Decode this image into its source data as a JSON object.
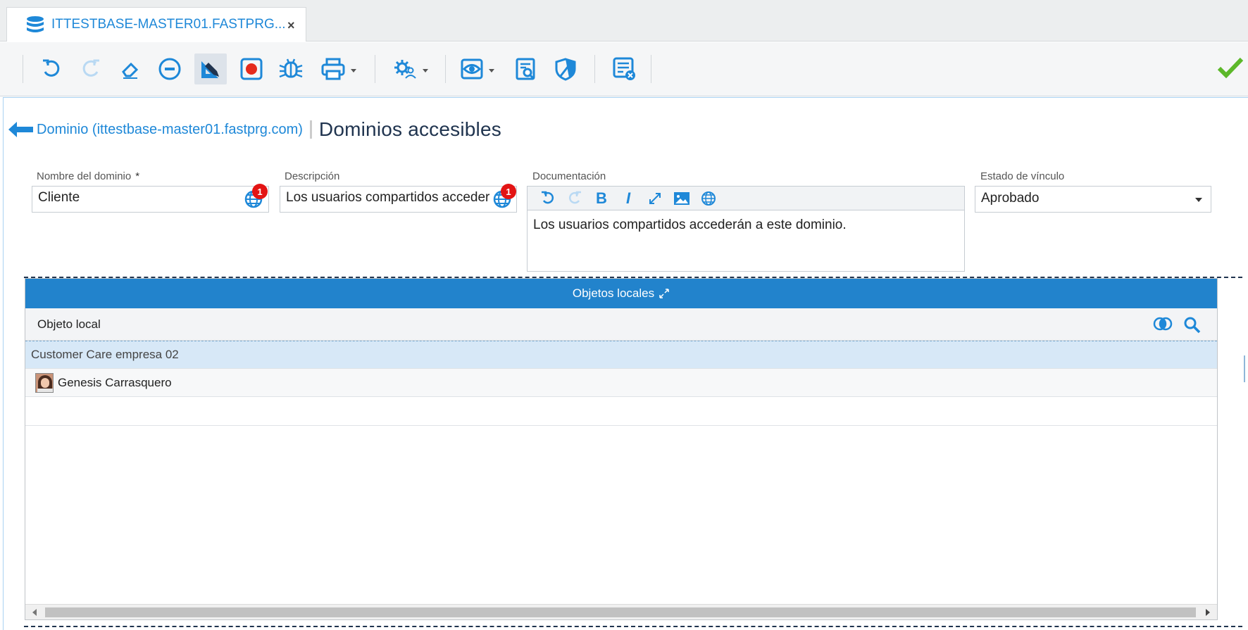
{
  "tab": {
    "title": "ITTESTBASE-MASTER01.FASTPRG...",
    "close": "×"
  },
  "toolbar": {
    "icons": [
      "undo-icon",
      "redo-icon",
      "eraser-icon",
      "minus-circle-icon",
      "design-mode-icon",
      "record-icon",
      "bug-icon",
      "print-icon",
      "settings-user-icon",
      "view-icon",
      "document-search-icon",
      "shield-icon",
      "list-delete-icon",
      "check-icon"
    ],
    "accent": "#1e88d8",
    "success": "#5cb82a"
  },
  "breadcrumb": {
    "parent": "Dominio (ittestbase-master01.fastprg.com)",
    "title": "Dominios accesibles"
  },
  "form": {
    "name_label": "Nombre del dominio",
    "name_required": "*",
    "name_value": "Cliente",
    "name_badge": "1",
    "desc_label": "Descripción",
    "desc_value": "Los usuarios compartidos acceder",
    "desc_badge": "1",
    "doc_label": "Documentación",
    "doc_toolbar": {
      "bold": "B",
      "italic": "I"
    },
    "doc_value": "Los usuarios compartidos accederán a este dominio.",
    "status_label": "Estado de vínculo",
    "status_value": "Aprobado"
  },
  "grid": {
    "header": "Objetos locales",
    "column": "Objeto local",
    "group_row": "Customer Care empresa 02",
    "rows": [
      {
        "name": "Genesis Carrasquero",
        "icon": "avatar"
      }
    ]
  }
}
